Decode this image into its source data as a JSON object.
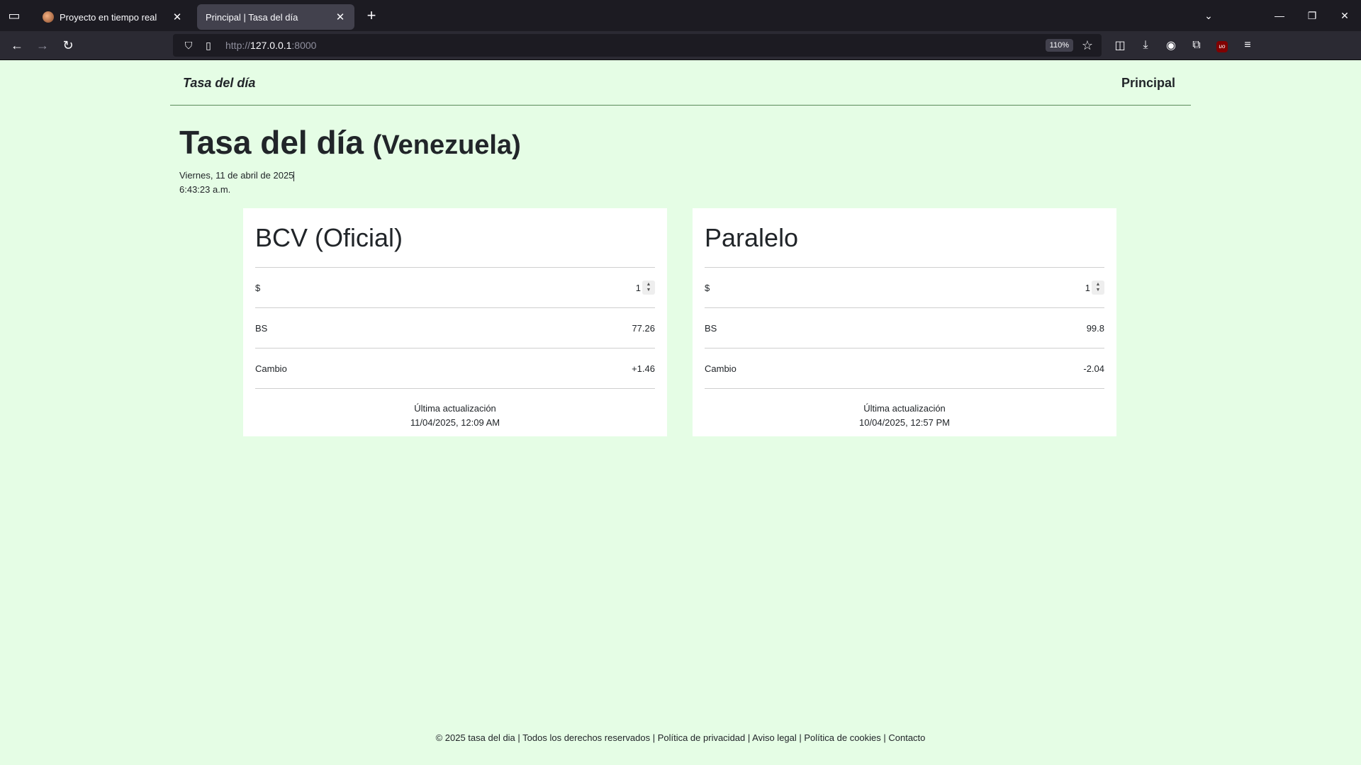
{
  "browser": {
    "tabs": [
      {
        "title": "Proyecto en tiempo real",
        "active": false
      },
      {
        "title": "Principal | Tasa del día",
        "active": true
      }
    ],
    "url_scheme": "http://",
    "url_host": "127.0.0.1",
    "url_port": ":8000",
    "zoom": "110%"
  },
  "header": {
    "brand": "Tasa del día",
    "nav_link": "Principal"
  },
  "hero": {
    "title": "Tasa del día",
    "subtitle": "(Venezuela)",
    "date": "Viernes, 11 de abril de 2025",
    "time": "6:43:23 a.m."
  },
  "cards": {
    "bcv": {
      "title": "BCV (Oficial)",
      "usd_label": "$",
      "usd_value": "1",
      "bs_label": "BS",
      "bs_value": "77.26",
      "change_label": "Cambio",
      "change_value": "+1.46",
      "updated_label": "Última actualización",
      "updated_value": "11/04/2025, 12:09 AM"
    },
    "paralelo": {
      "title": "Paralelo",
      "usd_label": "$",
      "usd_value": "1",
      "bs_label": "BS",
      "bs_value": "99.8",
      "change_label": "Cambio",
      "change_value": "-2.04",
      "updated_label": "Última actualización",
      "updated_value": "10/04/2025, 12:57 PM"
    }
  },
  "footer": {
    "text": "© 2025 tasa del dia | Todos los derechos reservados | Política de privacidad | Aviso legal | Política de cookies | Contacto"
  }
}
